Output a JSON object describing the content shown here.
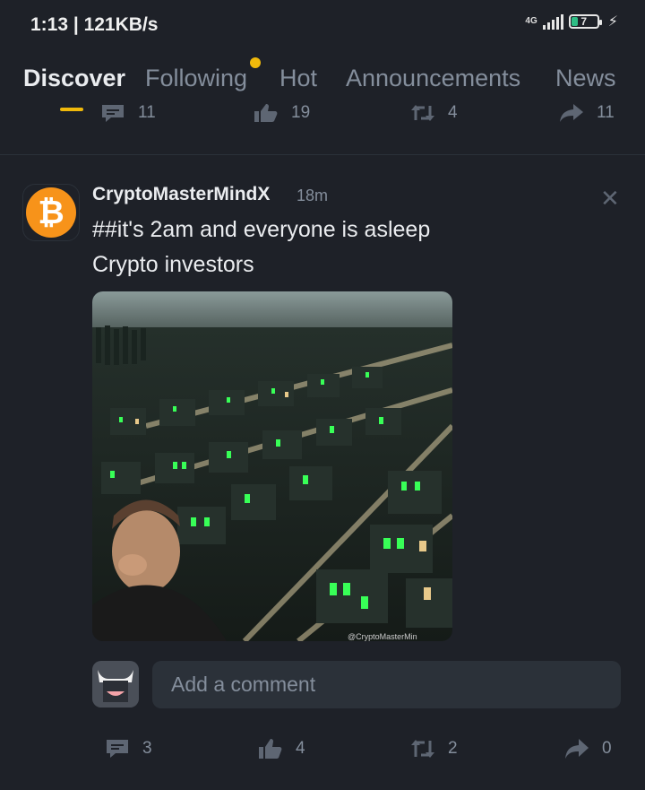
{
  "status_bar": {
    "time": "1:13 | 121KB/s",
    "network": "4G",
    "battery_level": "7",
    "battery_color": "#2ebd85"
  },
  "tabs": [
    {
      "label": "Discover",
      "active": true
    },
    {
      "label": "Following",
      "has_dot": true
    },
    {
      "label": "Hot"
    },
    {
      "label": "Announcements"
    },
    {
      "label": "News"
    }
  ],
  "colors": {
    "accent": "#f0b90b",
    "background": "#1e2128",
    "muted": "#848e9c"
  },
  "prev_post_actions": {
    "comments": "11",
    "likes": "19",
    "reposts": "4",
    "shares": "11"
  },
  "post": {
    "avatar_icon": "bitcoin-icon",
    "author": "CryptoMasterMindX",
    "time_ago": "18m",
    "text_line1": "##it's 2am and everyone is asleep",
    "text_line2": "Crypto investors",
    "image_watermark": "@CryptoMasterMin",
    "actions": {
      "comments": "3",
      "likes": "4",
      "reposts": "2",
      "shares": "0"
    }
  },
  "comment_box": {
    "placeholder": "Add a comment"
  }
}
